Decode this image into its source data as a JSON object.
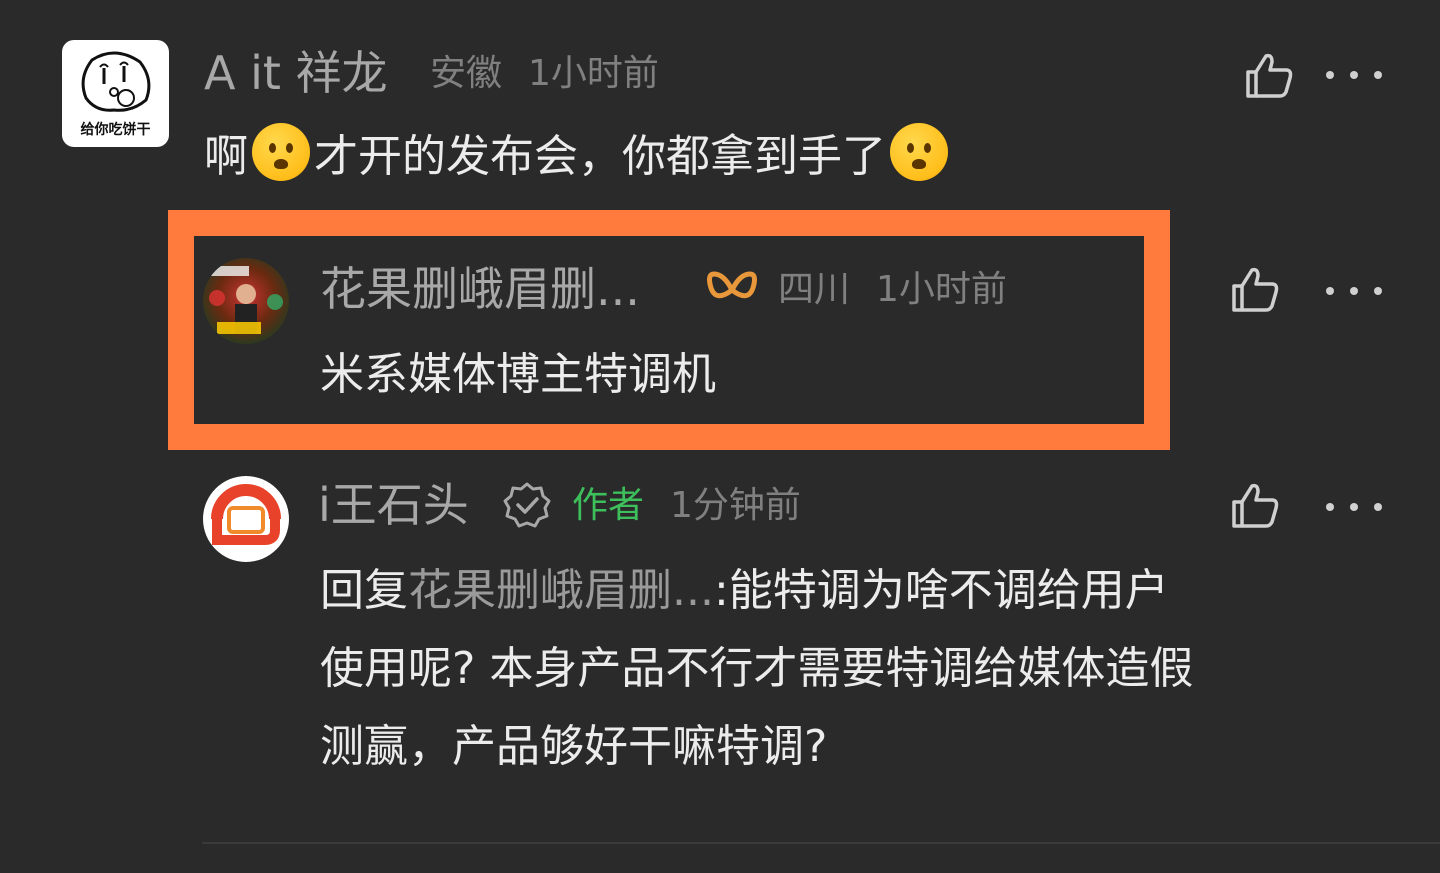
{
  "comment1": {
    "avatar_caption": "给你吃饼干",
    "name": "A it 祥龙",
    "location": "安徽",
    "time": "1小时前",
    "text_a": "啊",
    "text_b": "才开的发布会，你都拿到手了",
    "emoji": "astonished-face"
  },
  "comment2": {
    "name": "花果删峨眉删...",
    "badge_icon": "infinity-badge-icon",
    "location": "四川",
    "time": "1小时前",
    "text": "米系媒体博主特调机"
  },
  "comment3": {
    "name": "i王石头",
    "badge": "作者",
    "time": "1分钟前",
    "reply_prefix": "回复",
    "reply_to": "花果删峨眉删...",
    "line1_rest": ":能特调为啥不调给用户",
    "line2": "使用呢? 本身产品不行才需要特调给媒体造假",
    "line3": "测赢，产品够好干嘛特调?"
  },
  "colors": {
    "background": "#2a2a2a",
    "highlight": "#ff7a3d",
    "author_badge": "#3dbf5c",
    "infinity_badge": "#e8973a"
  }
}
